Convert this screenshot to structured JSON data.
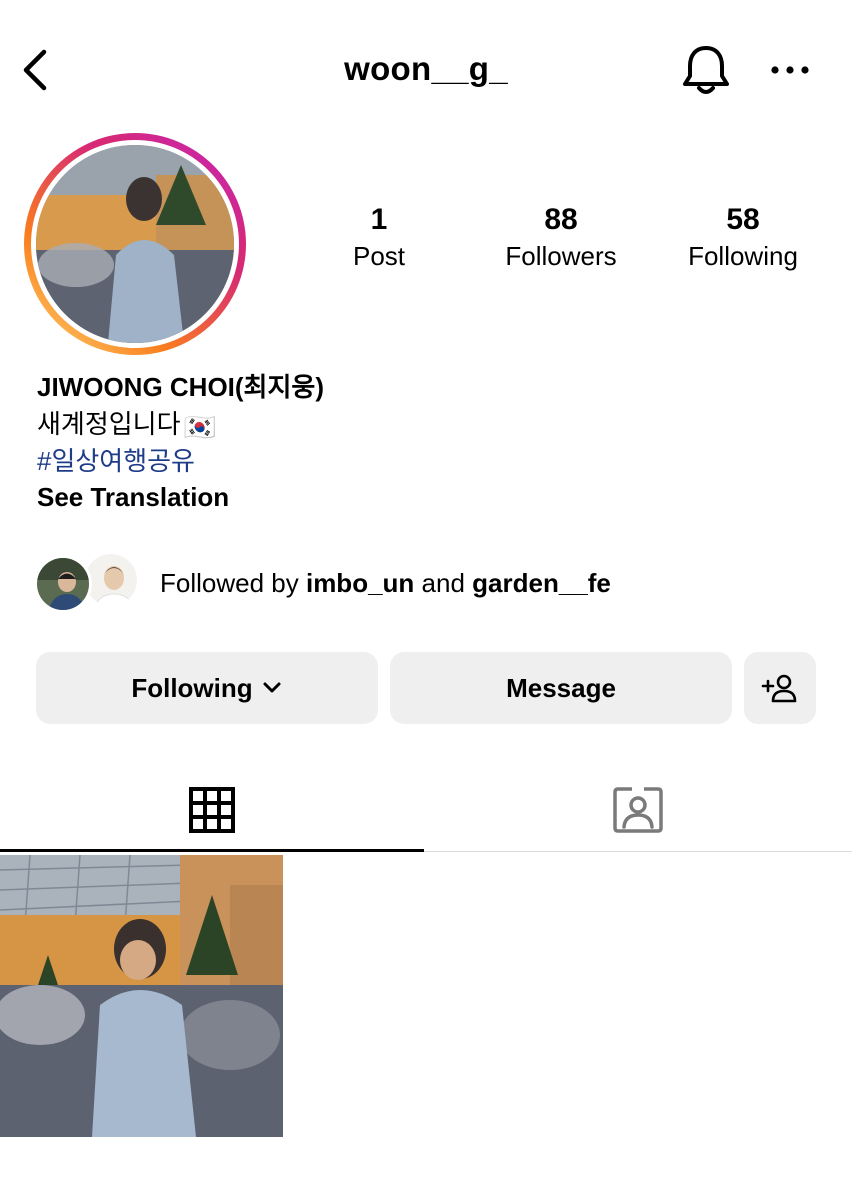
{
  "header": {
    "username": "woon__g_",
    "back_icon": "chevron-left-icon",
    "bell_icon": "bell-icon",
    "more_icon": "more-horizontal-icon"
  },
  "profile": {
    "stats": [
      {
        "value": "1",
        "label": "Post"
      },
      {
        "value": "88",
        "label": "Followers"
      },
      {
        "value": "58",
        "label": "Following"
      }
    ],
    "name": "JIWOONG CHOI(최지웅)",
    "bio_text": "새계정입니다",
    "bio_flag": "🇰🇷",
    "hashtag": "#일상여행공유",
    "see_translation": "See Translation"
  },
  "followed_by": {
    "prefix": "Followed by ",
    "user1": "imbo_un",
    "conjunction": " and ",
    "user2": "garden__fe"
  },
  "buttons": {
    "following": "Following",
    "message": "Message",
    "add_user_icon": "add-person-icon"
  },
  "tabs": [
    {
      "icon": "grid-icon",
      "active": true
    },
    {
      "icon": "tagged-person-icon",
      "active": false
    }
  ],
  "colors": {
    "link": "#1f3c88",
    "button_bg": "#efefef",
    "ring_start": "#feda75",
    "ring_end": "#c224c6"
  }
}
